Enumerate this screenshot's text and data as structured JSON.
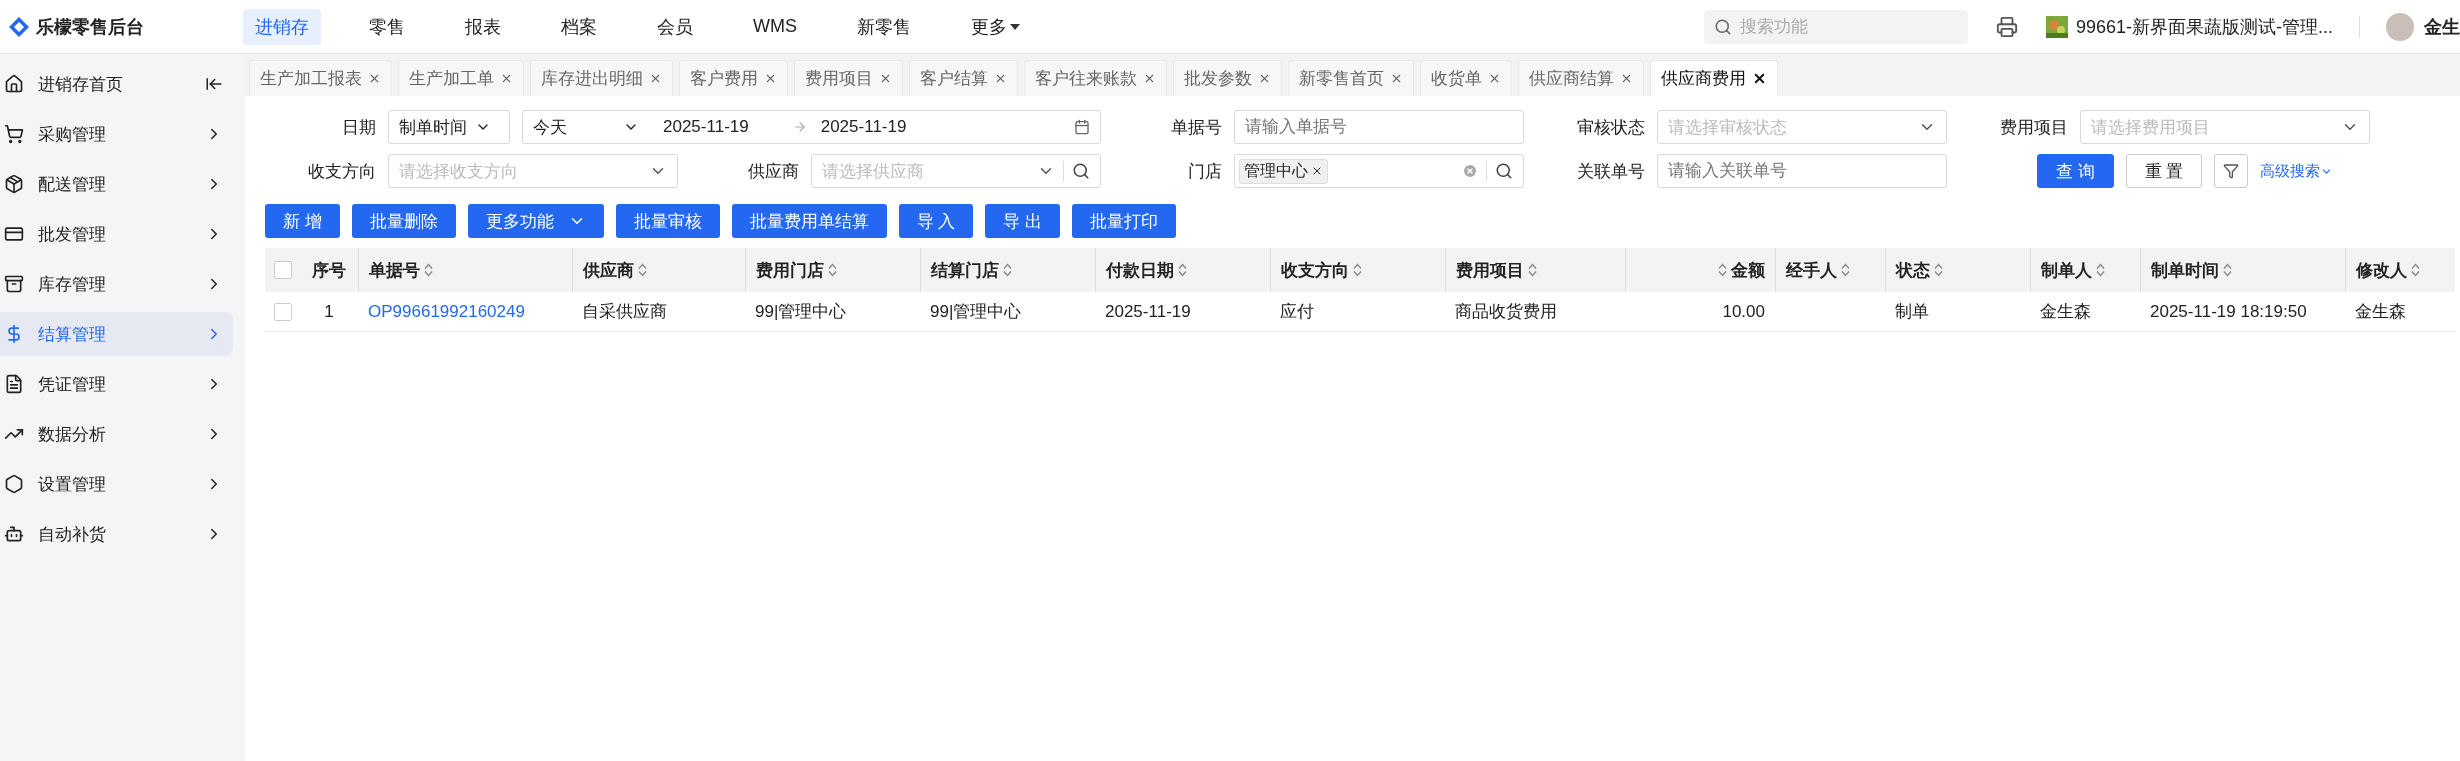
{
  "header": {
    "logo": "乐檬零售后台",
    "nav": [
      {
        "label": "进销存",
        "selected": true
      },
      {
        "label": "零售",
        "selected": false
      },
      {
        "label": "报表",
        "selected": false
      },
      {
        "label": "档案",
        "selected": false
      },
      {
        "label": "会员",
        "selected": false
      },
      {
        "label": "WMS",
        "selected": false
      },
      {
        "label": "新零售",
        "selected": false
      },
      {
        "label": "更多",
        "selected": false,
        "kind": "dropdown"
      }
    ],
    "search": {
      "placeholder": "搜索功能"
    },
    "store": "99661-新界面果蔬版测试-管理...",
    "user": "金生"
  },
  "sidebar": {
    "items": [
      {
        "label": "进销存首页",
        "selected": false
      },
      {
        "label": "采购管理",
        "selected": false
      },
      {
        "label": "配送管理",
        "selected": false
      },
      {
        "label": "批发管理",
        "selected": false
      },
      {
        "label": "库存管理",
        "selected": false
      },
      {
        "label": "结算管理",
        "selected": true
      },
      {
        "label": "凭证管理",
        "selected": false
      },
      {
        "label": "数据分析",
        "selected": false
      },
      {
        "label": "设置管理",
        "selected": false
      },
      {
        "label": "自动补货",
        "selected": false
      }
    ]
  },
  "tabs": [
    {
      "label": "生产加工报表",
      "selected": false
    },
    {
      "label": "生产加工单",
      "selected": false
    },
    {
      "label": "库存进出明细",
      "selected": false
    },
    {
      "label": "客户费用",
      "selected": false
    },
    {
      "label": "费用项目",
      "selected": false
    },
    {
      "label": "客户结算",
      "selected": false
    },
    {
      "label": "客户往来账款",
      "selected": false
    },
    {
      "label": "批发参数",
      "selected": false
    },
    {
      "label": "新零售首页",
      "selected": false
    },
    {
      "label": "收货单",
      "selected": false
    },
    {
      "label": "供应商结算",
      "selected": false
    },
    {
      "label": "供应商费用",
      "selected": true
    }
  ],
  "filters": {
    "fields": [
      {
        "kind": "daterange",
        "label": "日期",
        "type": "制单时间",
        "preset": "今天",
        "start": "2025-11-19",
        "end": "2025-11-19"
      },
      {
        "kind": "input",
        "label": "单据号",
        "placeholder": "请输入单据号"
      },
      {
        "kind": "select",
        "label": "审核状态",
        "placeholder": "请选择审核状态"
      },
      {
        "kind": "select",
        "label": "费用项目",
        "placeholder": "请选择费用项目"
      },
      {
        "kind": "select",
        "label": "收支方向",
        "placeholder": "请选择收支方向"
      },
      {
        "kind": "searchselect",
        "label": "供应商",
        "placeholder": "请选择供应商"
      },
      {
        "kind": "tags",
        "label": "门店",
        "tags": [
          "管理中心"
        ]
      },
      {
        "kind": "input",
        "label": "关联单号",
        "placeholder": "请输入关联单号"
      }
    ],
    "query": "查 询",
    "reset": "重 置",
    "advanced": "高级搜索"
  },
  "actions": [
    {
      "label": "新 增",
      "kind": "plain"
    },
    {
      "label": "批量删除",
      "kind": "plain"
    },
    {
      "label": "更多功能",
      "kind": "dropdown"
    },
    {
      "label": "批量审核",
      "kind": "plain"
    },
    {
      "label": "批量费用单结算",
      "kind": "plain"
    },
    {
      "label": "导 入",
      "kind": "plain"
    },
    {
      "label": "导 出",
      "kind": "plain"
    },
    {
      "label": "批量打印",
      "kind": "plain"
    }
  ],
  "table": {
    "all_checked": false,
    "columns": [
      "序号",
      "单据号",
      "供应商",
      "费用门店",
      "结算门店",
      "付款日期",
      "收支方向",
      "费用项目",
      "金额",
      "经手人",
      "状态",
      "制单人",
      "制单时间",
      "修改人"
    ],
    "rows": [
      {
        "checked": false,
        "cells": [
          "1",
          "OP99661992160249",
          "自采供应商",
          "99|管理中心",
          "99|管理中心",
          "2025-11-19",
          "应付",
          "商品收货费用",
          "10.00",
          "",
          "制单",
          "金生森",
          "2025-11-19 18:19:50",
          "金生森"
        ]
      }
    ]
  }
}
